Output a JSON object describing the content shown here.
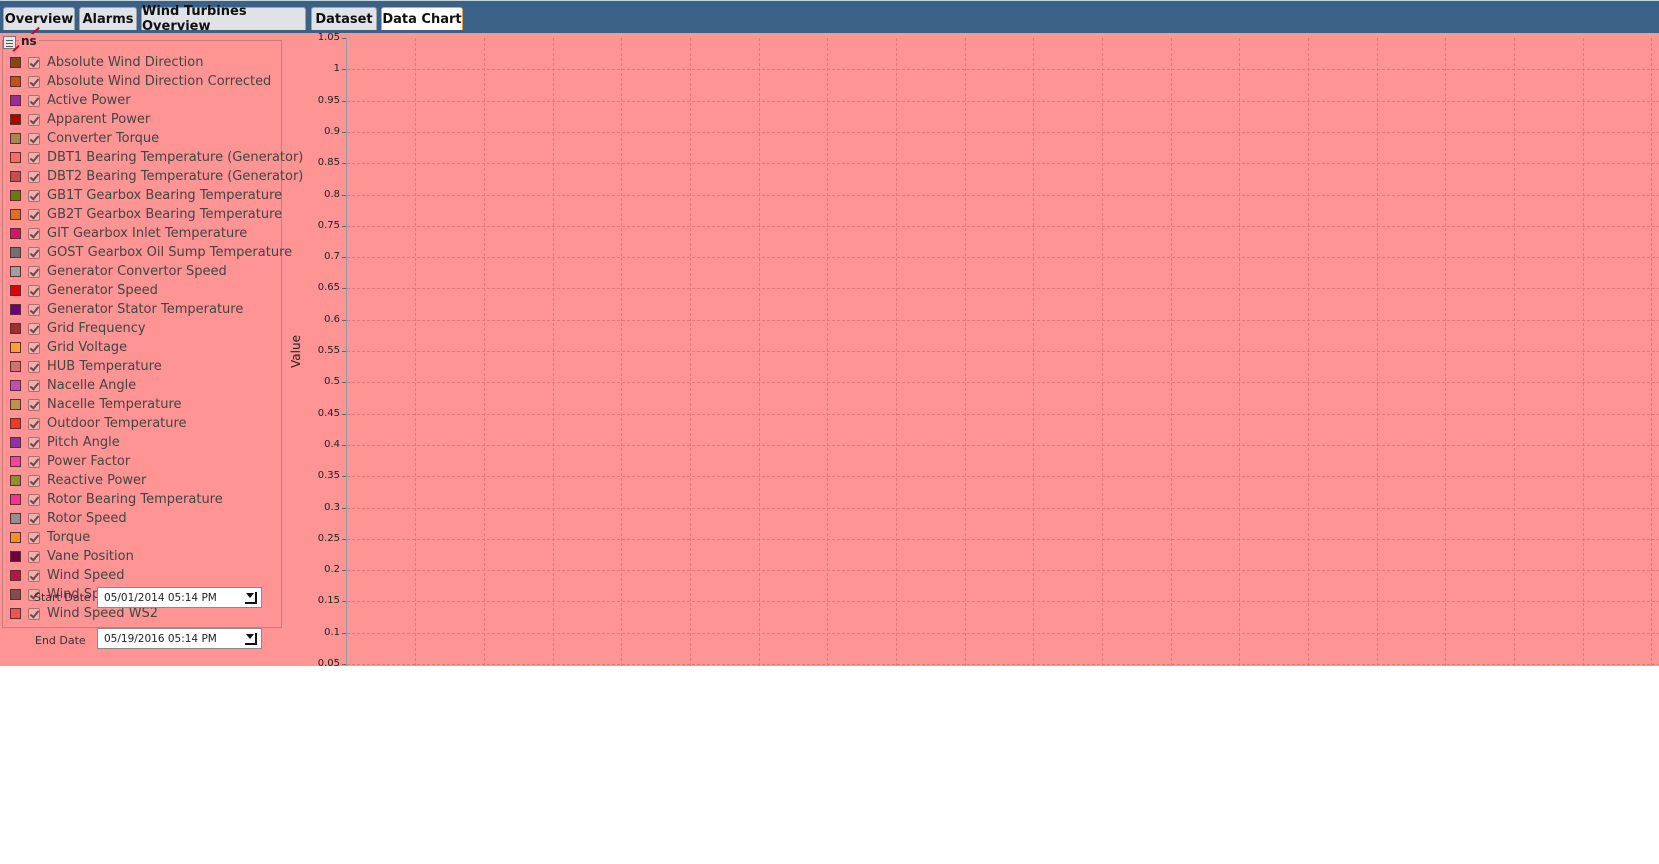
{
  "tabs": [
    {
      "label": "Overview",
      "active": false
    },
    {
      "label": "Alarms",
      "active": false
    },
    {
      "label": "Wind Turbines Overview",
      "active": false
    },
    {
      "label": "Dataset",
      "active": false
    },
    {
      "label": "Data Chart",
      "active": true
    }
  ],
  "items_panel": {
    "title": "ns",
    "items": [
      {
        "label": "Absolute Wind Direction",
        "color": "#8b4513",
        "checked": true
      },
      {
        "label": "Absolute Wind Direction Corrected",
        "color": "#c0531a",
        "checked": true
      },
      {
        "label": "Active Power",
        "color": "#9c2a9c",
        "checked": true
      },
      {
        "label": "Apparent Power",
        "color": "#b00000",
        "checked": true
      },
      {
        "label": "Converter Torque",
        "color": "#a48a4a",
        "checked": true
      },
      {
        "label": "DBT1 Bearing Temperature (Generator)",
        "color": "#ff6a6a",
        "checked": true
      },
      {
        "label": "DBT2 Bearing Temperature (Generator)",
        "color": "#c05050",
        "checked": true
      },
      {
        "label": "GB1T Gearbox Bearing Temperature",
        "color": "#6b7a10",
        "checked": true
      },
      {
        "label": "GB2T Gearbox Bearing Temperature",
        "color": "#e07020",
        "checked": true
      },
      {
        "label": "GIT Gearbox Inlet Temperature",
        "color": "#e0106a",
        "checked": true
      },
      {
        "label": "GOST Gearbox Oil Sump Temperature",
        "color": "#707070",
        "checked": true
      },
      {
        "label": "Generator Convertor Speed",
        "color": "#a0a0a0",
        "checked": true
      },
      {
        "label": "Generator Speed",
        "color": "#e00000",
        "checked": true
      },
      {
        "label": "Generator Stator Temperature",
        "color": "#6a0080",
        "checked": true
      },
      {
        "label": "Grid Frequency",
        "color": "#a03030",
        "checked": true
      },
      {
        "label": "Grid Voltage",
        "color": "#ffa030",
        "checked": true
      },
      {
        "label": "HUB Temperature",
        "color": "#d47070",
        "checked": true
      },
      {
        "label": "Nacelle Angle",
        "color": "#c050b0",
        "checked": true
      },
      {
        "label": "Nacelle Temperature",
        "color": "#c09050",
        "checked": true
      },
      {
        "label": "Outdoor Temperature",
        "color": "#ff3030",
        "checked": true
      },
      {
        "label": "Pitch Angle",
        "color": "#9030b0",
        "checked": true
      },
      {
        "label": "Power Factor",
        "color": "#ff40a0",
        "checked": true
      },
      {
        "label": "Reactive Power",
        "color": "#909030",
        "checked": true
      },
      {
        "label": "Rotor Bearing Temperature",
        "color": "#ff3090",
        "checked": true
      },
      {
        "label": "Rotor Speed",
        "color": "#909090",
        "checked": true
      },
      {
        "label": "Torque",
        "color": "#ff9020",
        "checked": true
      },
      {
        "label": "Vane Position",
        "color": "#700040",
        "checked": true
      },
      {
        "label": "Wind Speed",
        "color": "#c0104a",
        "checked": true
      },
      {
        "label": "Wind Spe",
        "color": "#805050",
        "checked": true
      },
      {
        "label": "Wind Speed WS2",
        "color": "#ff5050",
        "checked": true
      }
    ]
  },
  "start_date": {
    "label": "Start Date",
    "value": "05/01/2014 05:14 PM"
  },
  "end_date": {
    "label": "End Date",
    "value": "05/19/2016 05:14 PM"
  },
  "chart_data": {
    "type": "line",
    "ylabel": "Value",
    "ylim": [
      0.05,
      1.05
    ],
    "yticks": [
      "1.05",
      "1",
      "0.95",
      "0.9",
      "0.85",
      "0.8",
      "0.75",
      "0.7",
      "0.65",
      "0.6",
      "0.55",
      "0.5",
      "0.45",
      "0.4",
      "0.35",
      "0.3",
      "0.25",
      "0.2",
      "0.15",
      "0.1",
      "0.05"
    ],
    "grid": true,
    "series": []
  }
}
